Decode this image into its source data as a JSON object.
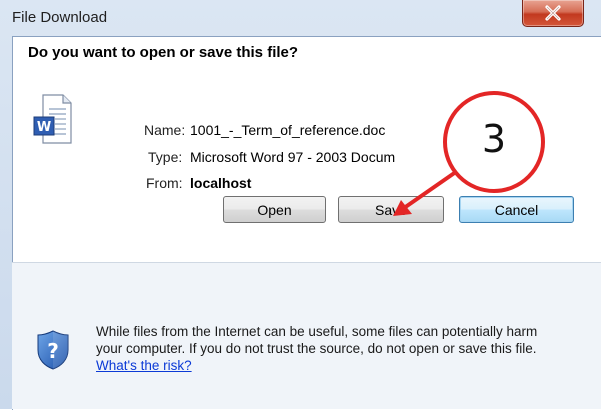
{
  "window": {
    "title": "File Download",
    "close_icon": "close-icon"
  },
  "dialog": {
    "question": "Do you want to open or save this file?",
    "file_icon": "word-document-icon",
    "name_label": "Name:",
    "name_value": "1001_-_Term_of_reference.doc",
    "type_label": "Type:",
    "type_value": "Microsoft Word 97 - 2003 Docum",
    "from_label": "From:",
    "from_value": "localhost"
  },
  "buttons": {
    "open": "Open",
    "save": "Save",
    "cancel": "Cancel"
  },
  "warning": {
    "icon": "shield-question-icon",
    "text": "While files from the Internet can be useful, some files can potentially harm your computer. If you do not trust the source, do not open or save this file.",
    "link": "What's the risk?"
  },
  "annotation": {
    "step_number": "3",
    "color": "#e32626"
  }
}
